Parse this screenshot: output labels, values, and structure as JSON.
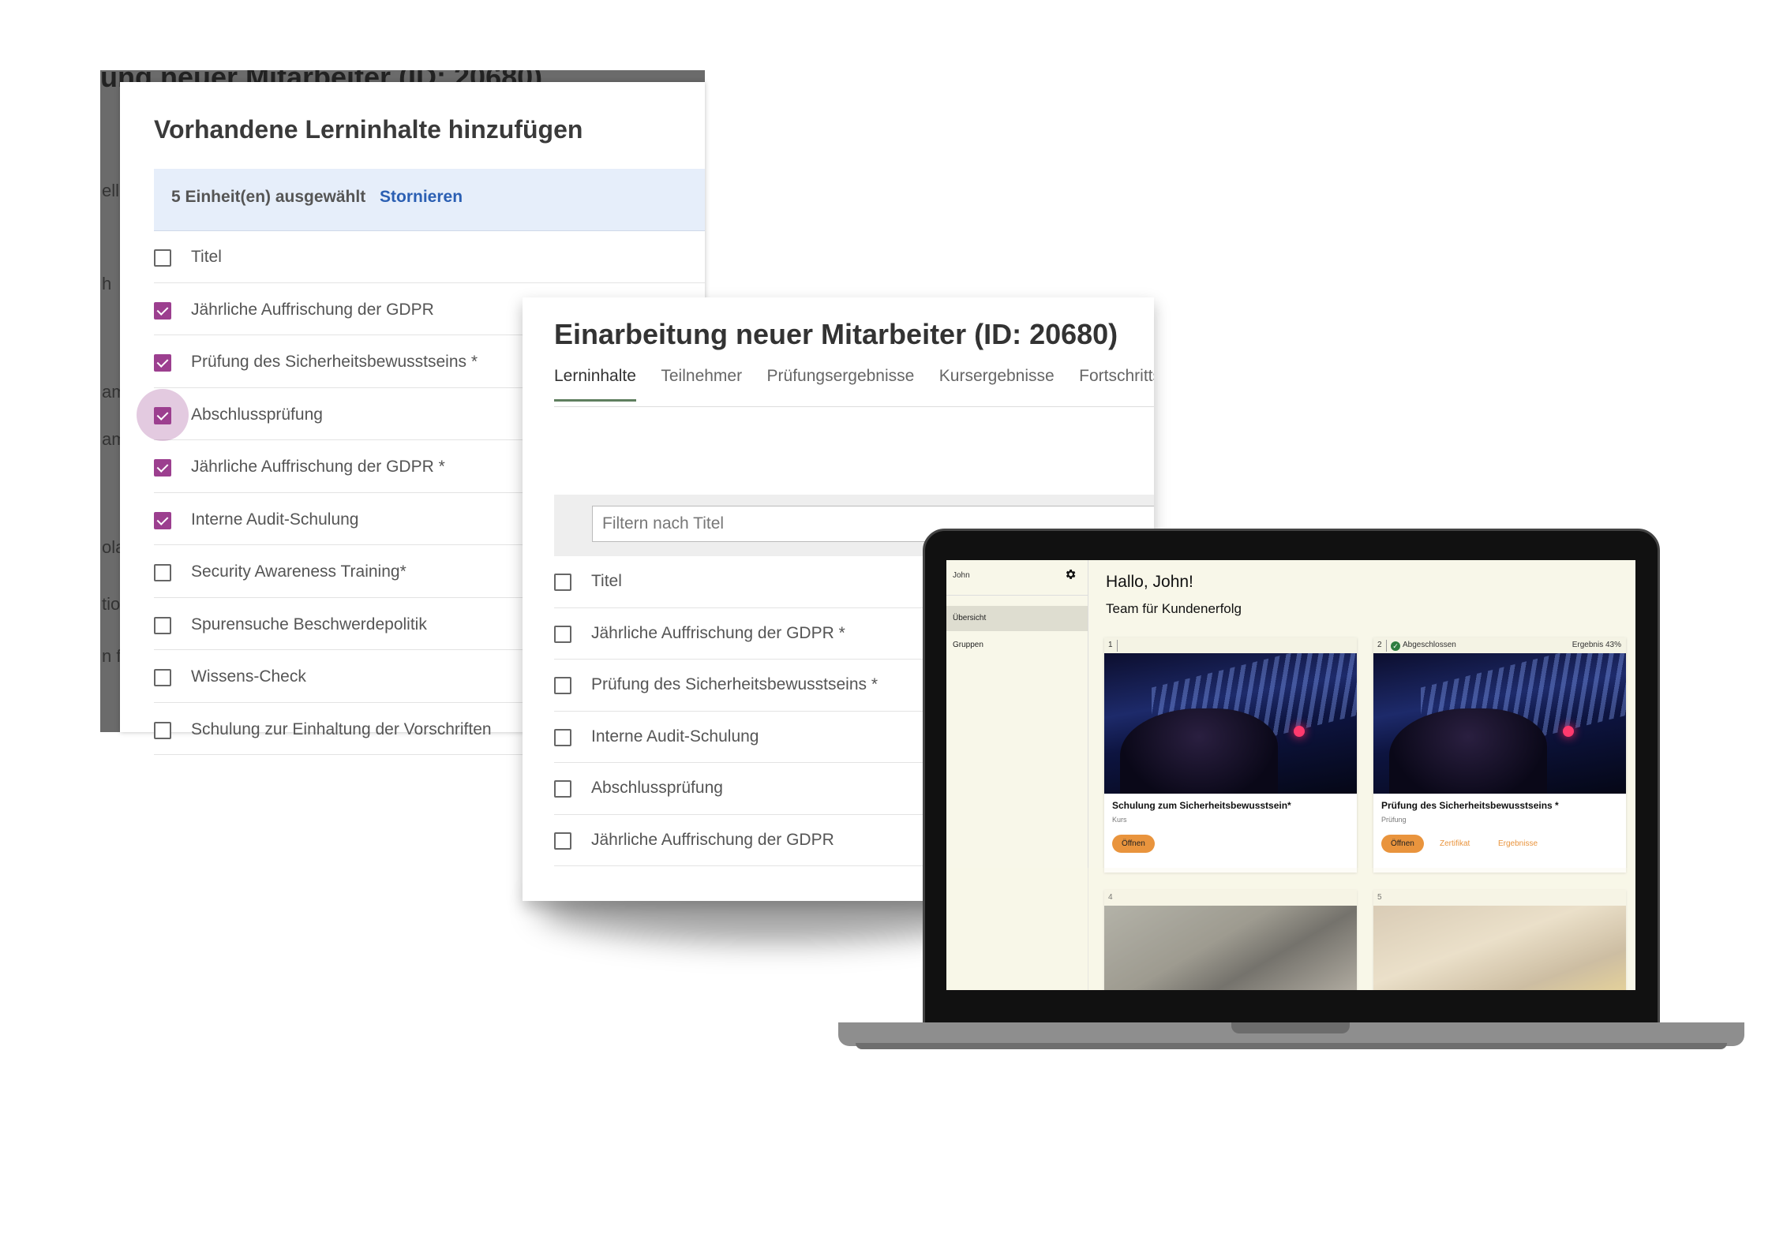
{
  "panel_back": {
    "background_title": "ung neuer Mitarbeiter (ID: 20680)",
    "ghost_text": [
      "ell",
      "h",
      "am",
      "am",
      "ola",
      "tio",
      "n f"
    ],
    "dialog_title": "Vorhandene Lerninhalte hinzufügen",
    "selection_text": "5 Einheit(en) ausgewählt",
    "cancel_label": "Stornieren",
    "header_label": "Titel",
    "items": [
      {
        "label": "Jährliche Auffrischung der GDPR",
        "checked": true
      },
      {
        "label": "Prüfung des Sicherheitsbewusstseins *",
        "checked": true
      },
      {
        "label": "Abschlussprüfung",
        "checked": true
      },
      {
        "label": "Jährliche Auffrischung der GDPR *",
        "checked": true
      },
      {
        "label": "Interne Audit-Schulung",
        "checked": true
      },
      {
        "label": "Security Awareness Training*",
        "checked": false
      },
      {
        "label": "Spurensuche Beschwerdepolitik",
        "checked": false
      },
      {
        "label": "Wissens-Check",
        "checked": false
      },
      {
        "label": "Schulung zur Einhaltung der Vorschriften",
        "checked": false
      }
    ],
    "accent_color": "#9c3f8f"
  },
  "panel_middle": {
    "title": "Einarbeitung neuer Mitarbeiter (ID: 20680)",
    "tabs": [
      "Lerninhalte",
      "Teilnehmer",
      "Prüfungsergebnisse",
      "Kursergebnisse",
      "Fortschrittsb"
    ],
    "active_tab": "Lerninhalte",
    "filter_placeholder": "Filtern nach Titel",
    "header_label": "Titel",
    "items": [
      "Jährliche Auffrischung der GDPR *",
      "Prüfung des Sicherheitsbewusstseins *",
      "Interne Audit-Schulung",
      "Abschlussprüfung",
      "Jährliche Auffrischung der GDPR"
    ]
  },
  "laptop": {
    "user_name": "John",
    "gear_icon": "gear-icon",
    "nav": [
      "Übersicht",
      "Gruppen"
    ],
    "greeting": "Hallo, John!",
    "team": "Team für Kundenerfolg",
    "cards": [
      {
        "number": "1",
        "status": "",
        "score": "",
        "title": "Schulung zum Sicherheitsbewusstsein*",
        "type": "Kurs",
        "open_label": "Öffnen"
      },
      {
        "number": "2",
        "status": "Abgeschlossen",
        "score": "Ergebnis 43%",
        "title": "Prüfung des Sicherheitsbewusstseins *",
        "type": "Prüfung",
        "open_label": "Öffnen",
        "certificate_label": "Zertifikat",
        "results_label": "Ergebnisse"
      },
      {
        "number": "4"
      },
      {
        "number": "5"
      }
    ],
    "accent_color": "#e9943d"
  }
}
